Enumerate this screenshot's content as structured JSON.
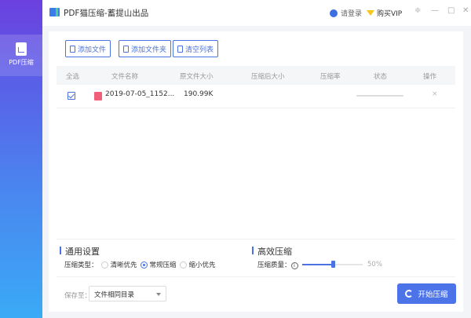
{
  "app": {
    "title": "PDF猫压缩-蓄提山出品",
    "login": "请登录",
    "vip": "购买VIP"
  },
  "sidebar": {
    "items": [
      {
        "label": "PDF压缩",
        "icon": "pdf-compress-icon",
        "active": true
      }
    ]
  },
  "toolbar": {
    "add_file": "添加文件",
    "add_folder": "添加文件夹",
    "clear_list": "清空列表"
  },
  "table": {
    "columns": [
      "全选",
      "文件名称",
      "原文件大小",
      "压缩后大小",
      "压缩率",
      "状态",
      "操作"
    ],
    "rows": [
      {
        "checked": true,
        "name": "2019-07-05_1152...",
        "original_size": "190.99K",
        "compressed_size": "",
        "ratio": "",
        "status": "",
        "action": "×"
      }
    ]
  },
  "general": {
    "title": "通用设置",
    "type_label": "压缩类型：",
    "options": [
      "清晰优先",
      "常规压缩",
      "缩小优先"
    ],
    "selected": "常规压缩"
  },
  "efficient": {
    "title": "高效压缩",
    "quality_label": "压缩质量：",
    "quality_value": 50,
    "quality_text": "50%"
  },
  "footer": {
    "save_label": "保存至：",
    "save_value": "文件相同目录",
    "start": "开始压缩"
  },
  "colors": {
    "accent": "#4c73e8"
  }
}
